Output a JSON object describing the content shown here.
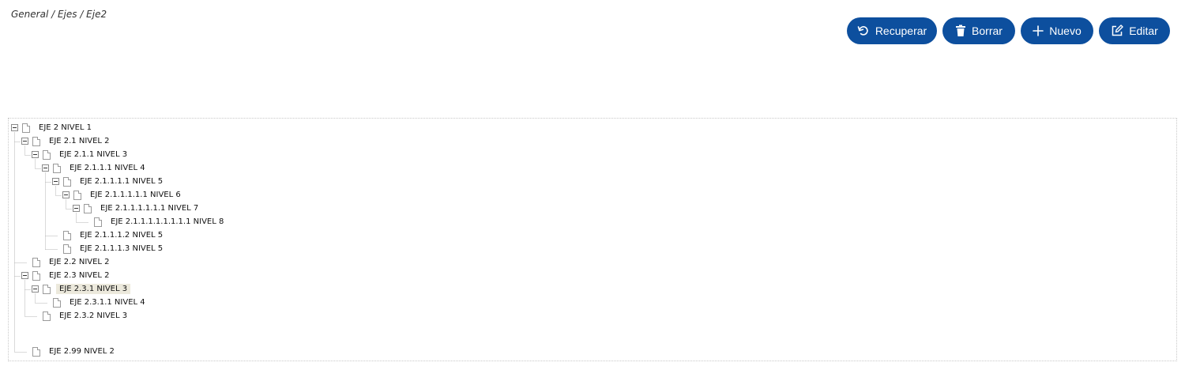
{
  "breadcrumb": "General / Ejes / Eje2",
  "toolbar": {
    "buttons": [
      {
        "label": "Recuperar",
        "icon": "undo-icon"
      },
      {
        "label": "Borrar",
        "icon": "trash-icon"
      },
      {
        "label": "Nuevo",
        "icon": "plus-icon"
      },
      {
        "label": "Editar",
        "icon": "edit-icon"
      }
    ]
  },
  "tree": {
    "nodes": [
      {
        "label": "EJE 2 NIVEL 1",
        "level": 0,
        "expanded": true
      },
      {
        "label": "EJE 2.1 NIVEL 2",
        "level": 1,
        "expanded": true
      },
      {
        "label": "EJE 2.1.1 NIVEL 3",
        "level": 2,
        "expanded": true
      },
      {
        "label": "EJE 2.1.1.1 NIVEL 4",
        "level": 3,
        "expanded": true
      },
      {
        "label": "EJE 2.1.1.1.1 NIVEL 5",
        "level": 4,
        "expanded": true
      },
      {
        "label": "EJE 2.1.1.1.1.1 NIVEL 6",
        "level": 5,
        "expanded": true
      },
      {
        "label": "EJE 2.1.1.1.1.1.1 NIVEL 7",
        "level": 6,
        "expanded": true
      },
      {
        "label": "EJE 2.1.1.1.1.1.1.1.1 NIVEL 8",
        "level": 7,
        "expanded": false
      },
      {
        "label": "EJE 2.1.1.1.2 NIVEL 5",
        "level": 4,
        "expanded": false
      },
      {
        "label": "EJE 2.1.1.1.3 NIVEL 5",
        "level": 4,
        "expanded": false
      },
      {
        "label": "EJE 2.2 NIVEL 2",
        "level": 1,
        "expanded": false
      },
      {
        "label": "EJE 2.3 NIVEL 2",
        "level": 1,
        "expanded": true
      },
      {
        "label": "EJE 2.3.1 NIVEL 3",
        "level": 2,
        "expanded": true,
        "selected": true
      },
      {
        "label": "EJE 2.3.1.1 NIVEL 4",
        "level": 3,
        "expanded": false
      },
      {
        "label": "EJE 2.3.2 NIVEL 3",
        "level": 2,
        "expanded": false
      },
      {
        "label": "EJE 2.99 NIVEL 2",
        "level": 1,
        "expanded": false
      }
    ]
  }
}
